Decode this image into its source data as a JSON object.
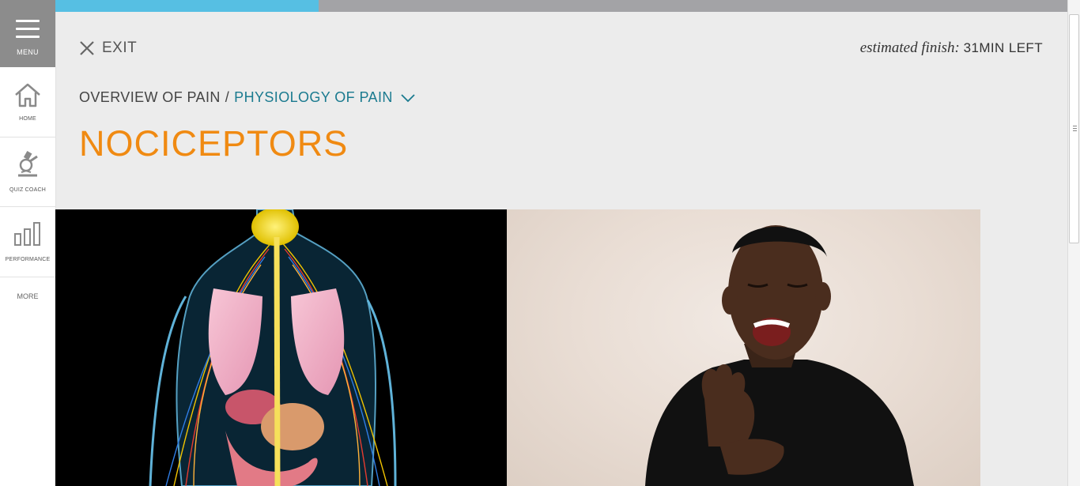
{
  "sidebar": {
    "menu_label": "MENU",
    "items": [
      {
        "label": "HOME"
      },
      {
        "label": "QUIZ COACH"
      },
      {
        "label": "PERFORMANCE"
      }
    ],
    "more_label": "MORE"
  },
  "progress": {
    "fraction": 0.26
  },
  "header": {
    "exit_label": "EXIT",
    "finish_prefix": "estimated finish:",
    "finish_time": "31MIN LEFT"
  },
  "breadcrumb": {
    "parent": "OVERVIEW OF PAIN",
    "separator": "/",
    "current": "PHYSIOLOGY OF PAIN"
  },
  "page_title": "NOCICEPTORS",
  "colors": {
    "accent_orange": "#f08a12",
    "breadcrumb_teal": "#1a7a8f",
    "progress_fill": "#56bfe3",
    "menu_bg": "#8c8c8c"
  },
  "images": {
    "left": "anatomy-nervous-system-illustration",
    "right": "man-in-pain-holding-hand-photo"
  }
}
